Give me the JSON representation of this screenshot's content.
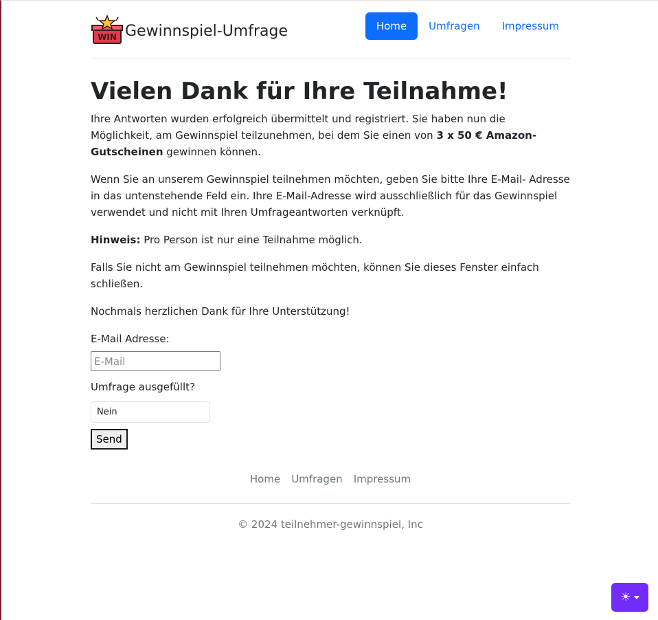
{
  "header": {
    "brand": "Gewinnspiel-Umfrage",
    "logo_text": "WIN",
    "nav": [
      {
        "label": "Home",
        "active": true
      },
      {
        "label": "Umfragen",
        "active": false
      },
      {
        "label": "Impressum",
        "active": false
      }
    ]
  },
  "main": {
    "title": "Vielen Dank für Ihre Teilnahme!",
    "p1_before": "Ihre Antworten wurden erfolgreich übermittelt und registriert. Sie haben nun die Möglichkeit, am Gewinnspiel teilzunehmen, bei dem Sie einen von ",
    "p1_bold": "3 x 50 € Amazon- Gutscheinen",
    "p1_after": " gewinnen können.",
    "p2": "Wenn Sie an unserem Gewinnspiel teilnehmen möchten, geben Sie bitte Ihre E-Mail- Adresse in das untenstehende Feld ein. Ihre E-Mail-Adresse wird ausschließlich für das Gewinnspiel verwendet und nicht mit Ihren Umfrageantworten verknüpft.",
    "p3_bold": "Hinweis:",
    "p3_rest": " Pro Person ist nur eine Teilnahme möglich.",
    "p4": "Falls Sie nicht am Gewinnspiel teilnehmen möchten, können Sie dieses Fenster einfach schließen.",
    "p5": "Nochmals herzlichen Dank für Ihre Unterstützung!"
  },
  "form": {
    "email_label": "E-Mail Adresse:",
    "email_placeholder": "E-Mail",
    "survey_label": "Umfrage ausgefüllt?",
    "survey_value": "Nein",
    "send_label": "Send"
  },
  "footer": {
    "links": [
      "Home",
      "Umfragen",
      "Impressum"
    ],
    "copyright": "© 2024 teilnehmer-gewinnspiel, Inc"
  },
  "theme_toggle": {
    "icon": "sun-icon",
    "color": "#712cf9"
  },
  "colors": {
    "primary": "#0d6efd",
    "text": "#212529",
    "muted": "#6c757d"
  }
}
